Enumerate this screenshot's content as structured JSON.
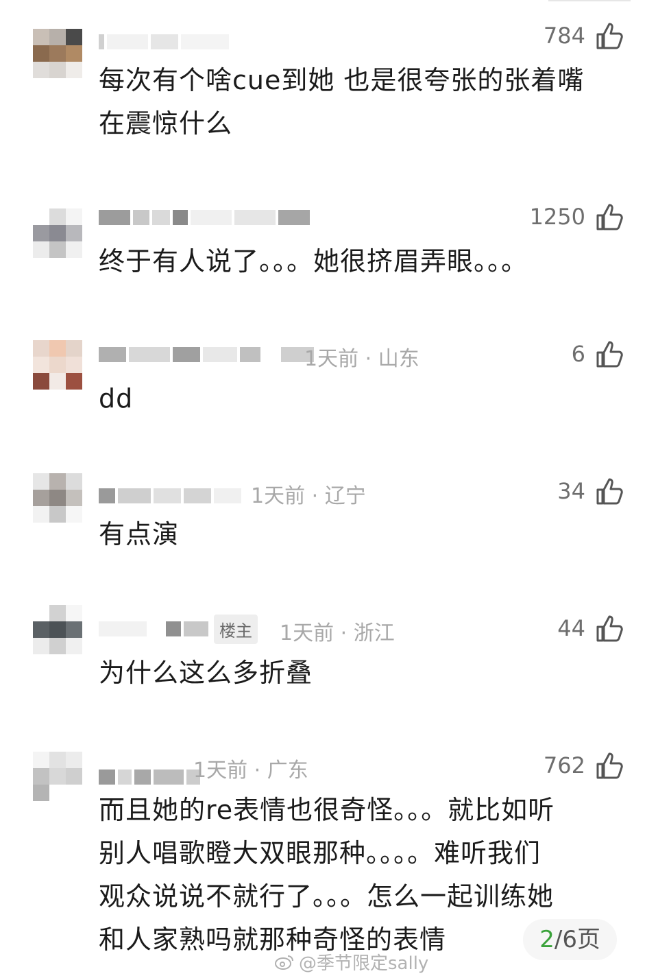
{
  "comments": [
    {
      "meta": "",
      "badge": "",
      "likes": "784",
      "lines": [
        "每次有个啥cue到她 也是很夸张的张着嘴",
        "在震惊什么"
      ]
    },
    {
      "meta": "",
      "badge": "",
      "likes": "1250",
      "lines": [
        "终于有人说了。。。她很挤眉弄眼。。。"
      ]
    },
    {
      "meta": "1天前 · 山东",
      "badge": "",
      "likes": "6",
      "lines": [
        "dd"
      ]
    },
    {
      "meta": "1天前 · 辽宁",
      "badge": "",
      "likes": "34",
      "lines": [
        "有点演"
      ]
    },
    {
      "meta": "1天前 · 浙江",
      "badge": "楼主",
      "likes": "44",
      "lines": [
        "为什么这么多折叠"
      ]
    },
    {
      "meta": "1天前 · 广东",
      "badge": "",
      "likes": "762",
      "lines": [
        "而且她的re表情也很奇怪。。。就比如听",
        "别人唱歌瞪大双眼那种。。。。难听我们",
        "观众说说不就行了。。。怎么一起训练她",
        "和人家熟吗就那种奇怪的表情"
      ]
    }
  ],
  "pager": {
    "current": "2",
    "total": "/6页"
  },
  "watermark": "@季节限定sally",
  "icons": {
    "like": "thumbs-up-icon",
    "weibo": "weibo-logo-icon"
  },
  "colors": {
    "pager_current": "#3aa23a",
    "meta": "#a8a8a8",
    "text": "#1b1b1b"
  }
}
